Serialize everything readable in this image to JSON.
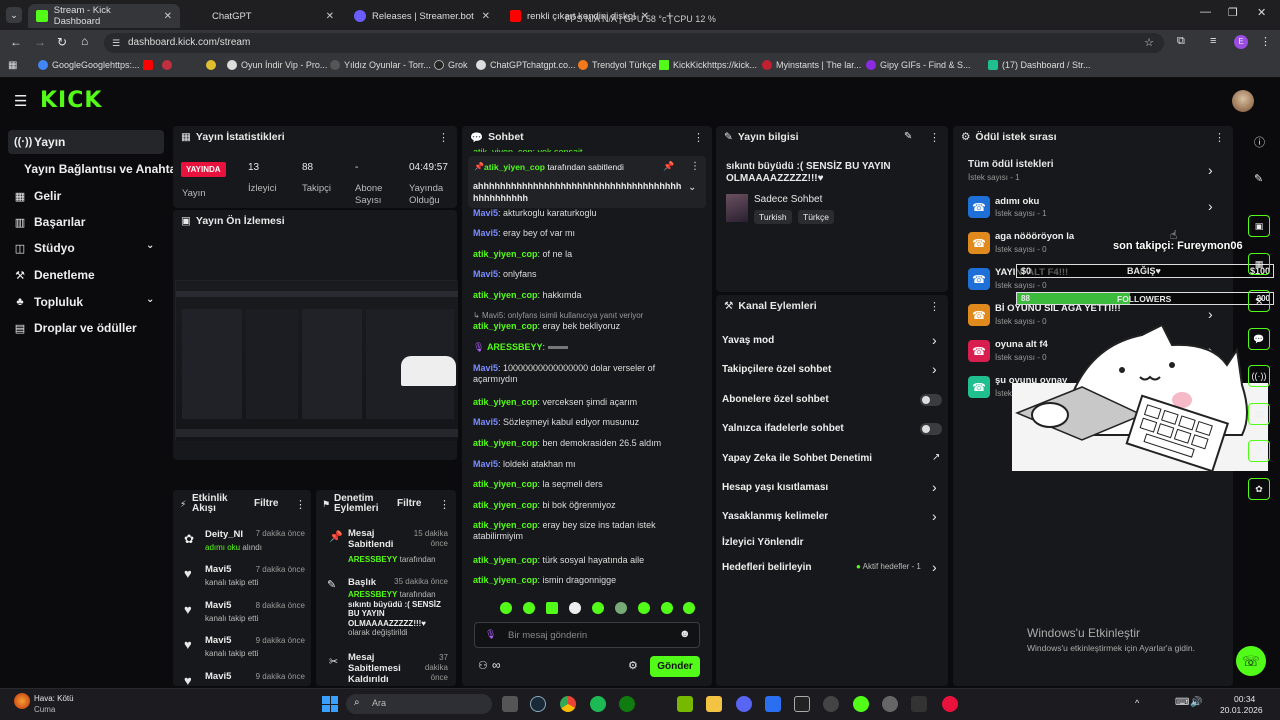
{
  "browser": {
    "tabs": [
      {
        "label": "Stream - Kick Dashboard",
        "active": true
      },
      {
        "label": "ChatGPT"
      },
      {
        "label": "Releases | Streamer.bot"
      },
      {
        "label": "renkli çıkart kendini diskolara"
      }
    ],
    "overlay_stats": "FPS N/A N/A | GPU 58 °c | CPU 12 %",
    "url": "dashboard.kick.com/stream",
    "bookmarks": [
      "GoogleGooglehttps:...",
      "Oyun İndir Vip - Pro...",
      "Yıldız Oyunlar - Torr...",
      "Grok",
      "ChatGPTchatgpt.co...",
      "Trendyol Türkçe",
      "KickKickhttps://kick...",
      "Myinstants | The lar...",
      "Gipy GIFs - Find & S...",
      "(17) Dashboard / Str..."
    ]
  },
  "sidebar": {
    "items": [
      {
        "label": "Yayın",
        "icon": "broadcast-icon"
      },
      {
        "label": "Yayın Bağlantısı ve Anahtarı",
        "icon": ""
      },
      {
        "label": "Gelir",
        "icon": "revenue-icon"
      },
      {
        "label": "Başarılar",
        "icon": "achievements-icon"
      },
      {
        "label": "Stüdyo",
        "icon": "studio-icon"
      },
      {
        "label": "Denetleme",
        "icon": "moderation-icon"
      },
      {
        "label": "Topluluk",
        "icon": "community-icon"
      },
      {
        "label": "Droplar ve ödüller",
        "icon": "drops-icon"
      }
    ]
  },
  "stats": {
    "title": "Yayın İstatistikleri",
    "live_badge": "YAYINDA",
    "live_label": "Yayın",
    "viewers_value": "13",
    "viewers_label": "İzleyici",
    "followers_value": "88",
    "followers_label": "Takipçi",
    "subs_value": "-",
    "subs_label": "Abone Sayısı",
    "uptime_value": "04:49:57",
    "uptime_label": "Yayında Olduğu"
  },
  "preview": {
    "title": "Yayın Ön İzlemesi"
  },
  "activity": {
    "title": "Etkinlik Akışı",
    "filter": "Filtre",
    "items": [
      {
        "name": "Deity_NI",
        "sub": "adımı oku alındı",
        "time": "7 dakika önce"
      },
      {
        "name": "Mavi5",
        "sub": "kanalı takip etti",
        "time": "7 dakika önce"
      },
      {
        "name": "Mavi5",
        "sub": "kanalı takip etti",
        "time": "8 dakika önce"
      },
      {
        "name": "Mavi5",
        "sub": "kanalı takip etti",
        "time": "9 dakika önce"
      },
      {
        "name": "Mavi5",
        "sub": "",
        "time": "9 dakika önce"
      }
    ]
  },
  "modlog": {
    "title": "Denetim Eylemleri",
    "filter": "Filtre",
    "items": [
      {
        "title": "Mesaj Sabitlendi",
        "by": "ARESSBEYY",
        "suffix": "tarafından",
        "time": "15 dakika önce"
      },
      {
        "title": "Başlık",
        "by": "ARESSBEYY",
        "suffix": "tarafından",
        "detail": "sıkıntı büyüdü :( SENSİZ BU YAYIN OLMAAAAZZZZZ!!!♥",
        "detail2": "olarak değiştirildi",
        "time": "35 dakika önce"
      },
      {
        "title": "Mesaj Sabitlemesi Kaldırıldı",
        "time": "37 dakika önce"
      }
    ]
  },
  "chat": {
    "title": "Sohbet",
    "pinned_by": "atik_yiyen_cop",
    "pinned_suffix": "tarafından sabitlendi",
    "pinned_text": "ahhhhhhhhhhhhhhhhhhhhhhhhhhhhhhhhhhhhhhhhhhhhhhh",
    "top_cut": "atik_yiyen_cop: yok sensait",
    "messages": [
      {
        "user": "Mavi5",
        "text": ": akturkoglu karaturkoglu",
        "color": "u2"
      },
      {
        "user": "Mavi5",
        "text": ": eray bey of var mı",
        "color": "u2"
      },
      {
        "user": "atik_yiyen_cop",
        "text": ": of ne la",
        "color": "u1"
      },
      {
        "user": "Mavi5",
        "text": ": onlyfans",
        "color": "u2"
      },
      {
        "user": "atik_yiyen_cop",
        "text": ": hakkımda",
        "color": "u1"
      },
      {
        "user": "Mavi5",
        "text": ": onlyfans isimli kullanıcıya yanıt veriyor",
        "color": "reply"
      },
      {
        "user": "atik_yiyen_cop",
        "text": ": eray bek bekliyoruz",
        "color": "u1"
      },
      {
        "user": "ARESSBEYY",
        "text": ":",
        "color": "u1"
      },
      {
        "user": "Mavi5",
        "text": ": 10000000000000000 dolar verseler of açarmıydın",
        "color": "u2"
      },
      {
        "user": "atik_yiyen_cop",
        "text": ": verceksen şimdi açarım",
        "color": "u1"
      },
      {
        "user": "Mavi5",
        "text": ": Sözleşmeyi kabul ediyor musunuz",
        "color": "u2"
      },
      {
        "user": "atik_yiyen_cop",
        "text": ": ben demokrasiden 26.5 aldım",
        "color": "u1"
      },
      {
        "user": "Mavi5",
        "text": ": loldeki atakhan mı",
        "color": "u2"
      },
      {
        "user": "atik_yiyen_cop",
        "text": ": la seçmeli ders",
        "color": "u1"
      },
      {
        "user": "atik_yiyen_cop",
        "text": ": bi bok öğrenmiyoz",
        "color": "u1"
      },
      {
        "user": "atik_yiyen_cop",
        "text": ": eray bey size ins tadan istek atabilirmiyim",
        "color": "u1"
      },
      {
        "user": "atik_yiyen_cop",
        "text": ": türk sosyal hayatında aile",
        "color": "u1"
      },
      {
        "user": "atik_yiyen_cop",
        "text": ": ismin dragonnigge",
        "color": "u1"
      }
    ],
    "input_placeholder": "Bir mesaj gönderin",
    "send_label": "Gönder"
  },
  "stream_info": {
    "title": "Yayın bilgisi",
    "stream_title": "sıkıntı büyüdü :( SENSİZ BU YAYIN OLMAAAAZZZZZ!!!♥",
    "category": "Sadece Sohbet",
    "tags": [
      "Turkish",
      "Türkçe"
    ]
  },
  "channel_actions": {
    "title": "Kanal Eylemleri",
    "items": [
      {
        "label": "Yavaş mod",
        "control": "chevron"
      },
      {
        "label": "Takipçilere özel sohbet",
        "control": "chevron"
      },
      {
        "label": "Abonelere özel sohbet",
        "control": "toggle"
      },
      {
        "label": "Yalnızca ifadelerle sohbet",
        "control": "toggle"
      },
      {
        "label": "Yapay Zeka ile Sohbet Denetimi",
        "control": "external"
      },
      {
        "label": "Hesap yaşı kısıtlaması",
        "control": "chevron"
      },
      {
        "label": "Yasaklanmış kelimeler",
        "control": "chevron"
      },
      {
        "label": "İzleyici Yönlendir",
        "control": "none"
      },
      {
        "label": "Hedefleri belirleyin",
        "control": "chevron"
      }
    ],
    "goals_status": "Aktif hedefler - 1"
  },
  "rewards": {
    "title": "Ödül istek sırası",
    "all_label": "Tüm ödül istekleri",
    "all_count": "İstek sayısı - 1",
    "items": [
      {
        "title": "adımı oku",
        "count": "İstek sayısı - 1",
        "color": "#1f6fd8"
      },
      {
        "title": "aga nöööröyon la",
        "count": "İstek sayısı - 0",
        "color": "#e08a1e"
      },
      {
        "title": "YAYINI ALT F4!!!",
        "count": "İstek sayısı - 0",
        "color": "#1f6fd8"
      },
      {
        "title": "Bİ OYUNU SİL AGA YETTİ!!!",
        "count": "İstek sayısı - 0",
        "color": "#e08a1e"
      },
      {
        "title": "oyuna alt f4",
        "count": "İstek sayısı - 0",
        "color": "#d81e4e"
      },
      {
        "title": "şu oyunu oynay",
        "count": "İstek sayısı - 0",
        "color": "#1fbf8f"
      }
    ]
  },
  "overlay": {
    "last_follower": "son takipçi: Fureymon06",
    "donation_label": "BAĞIŞ♥",
    "donation_left": "$0",
    "donation_right": "$100",
    "followers_label": "FOLLOWERS",
    "followers_left": "88",
    "followers_right": "200",
    "followers_progress": 0.44
  },
  "windows": {
    "activation_title": "Windows'u Etkinleştir",
    "activation_sub": "Windows'u etkinleştirmek için Ayarlar'a gidin.",
    "weather_title": "Hava: Kötü",
    "weather_sub": "Cuma",
    "search": "Ara",
    "time": "00:34",
    "date": "20.01.2026"
  }
}
